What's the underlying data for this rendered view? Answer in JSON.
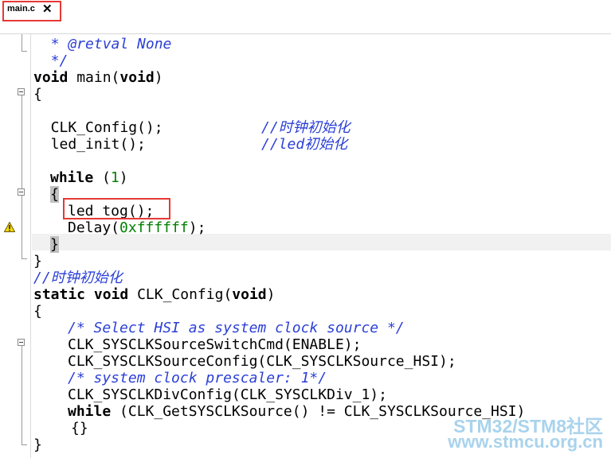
{
  "tab": {
    "label": "main.c",
    "close": "✕"
  },
  "code": {
    "l1": "  * @retval None",
    "l2": "  */",
    "l3_kw1": "void",
    "l3_mid": " main(",
    "l3_kw2": "void",
    "l3_end": ")",
    "l4": "{",
    "l6_code": "  CLK_Config();",
    "l6_comment": "//时钟初始化",
    "l7_code": "  led_init();",
    "l7_comment": "//led初始化",
    "l9_kw": "while",
    "l9_rest_a": " (",
    "l9_num": "1",
    "l9_rest_b": ")",
    "l10": "{",
    "l11": "led_tog();",
    "l12_a": "Delay(",
    "l12_num": "0xffffff",
    "l12_b": ");",
    "l13": "}",
    "l14": "}",
    "l15": "//时钟初始化",
    "l16_kw1": "static",
    "l16_kw2": "void",
    "l16_mid": " CLK_Config(",
    "l16_kw3": "void",
    "l16_end": ")",
    "l17": "{",
    "l18": "/* Select HSI as system clock source */",
    "l19": "CLK_SYSCLKSourceSwitchCmd(ENABLE);",
    "l20": "CLK_SYSCLKSourceConfig(CLK_SYSCLKSource_HSI);",
    "l21": "/* system clock prescaler: 1*/",
    "l22": "CLK_SYSCLKDivConfig(CLK_SYSCLKDiv_1);",
    "l23_kw": "while",
    "l23_rest": " (CLK_GetSYSCLKSource() != CLK_SYSCLKSource_HSI)",
    "l24": "{}",
    "l25": "}"
  },
  "watermark": {
    "line1": "STM32/STM8社区",
    "line2": "www.stmcu.org.cn"
  },
  "colors": {
    "comment": "#2b3fd6",
    "number": "#008000",
    "callout": "#e53935",
    "watermark": "#a9d3ec"
  }
}
